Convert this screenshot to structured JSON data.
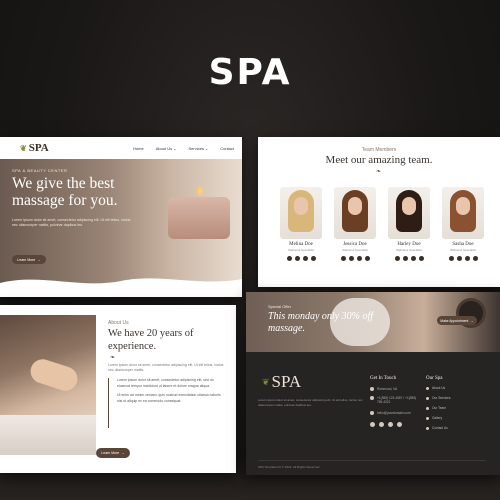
{
  "page": {
    "title": "SPA"
  },
  "hero_card": {
    "logo": "SPA",
    "nav": [
      {
        "label": "Home"
      },
      {
        "label": "About Us"
      },
      {
        "label": "Services"
      },
      {
        "label": "Contact"
      }
    ],
    "eyebrow": "SPA & BEAUTY CENTER",
    "heading": "We give the best massage for you.",
    "description": "Lorem ipsum dolor sit amet, consectetur adipiscing elit. Ut elit tellus, luctus nec ullamcorper mattis, pulvinar dapibus leo.",
    "button": "Learn More"
  },
  "team_card": {
    "eyebrow": "Team Members",
    "heading": "Meet our amazing team.",
    "members": [
      {
        "name": "Melina Doe",
        "role": "Wellness Specialist"
      },
      {
        "name": "Jessica Doe",
        "role": "Wellness Specialist"
      },
      {
        "name": "Harley Doe",
        "role": "Wellness Specialist"
      },
      {
        "name": "Sasha Doe",
        "role": "Wellness Specialist"
      }
    ]
  },
  "about_card": {
    "eyebrow": "About Us",
    "heading": "We have 20 years of experience.",
    "intro": "Lorem ipsum dolor sit amet, consectetur adipiscing elit. Ut elit tellus, luctus nec ullamcorper mattis.",
    "quote_1": "Lorem ipsum dolor sit amet, consectetur adipiscing elit, sed do eiusmod tempor incididunt ut labore et dolore magna aliqua.",
    "quote_2": "Ut enim ad minim veniam, quis nostrud exercitation ullamco laboris nisi ut aliquip ex ea commodo consequat.",
    "button": "Learn More"
  },
  "offer_card": {
    "eyebrow": "Special Offer",
    "heading": "This monday only 30% off massage.",
    "button": "Make Appointment"
  },
  "footer": {
    "logo": "SPA",
    "about": "Lorem ipsum dolor sit amet, consectetur adipiscing elit. Ut elit tellus, luctus nec ullamcorper mattis, pulvinar dapibus leo.",
    "contact_heading": "Get In Touch",
    "address": "Richmond, VA",
    "phone": "+1(555) 123-4567 / +1(555) 765-4321",
    "email": "hello@yourdomain.com",
    "links_heading": "Our Spa",
    "links": [
      {
        "label": "About Us"
      },
      {
        "label": "Our Services"
      },
      {
        "label": "Our Team"
      },
      {
        "label": "Gallery"
      },
      {
        "label": "Contact Us"
      }
    ],
    "copyright": "SPA Template Kit © 2022. All Rights Reserved."
  },
  "colors": {
    "brand_brown": "#5a4638",
    "leaf_green": "#7a8b3a",
    "footer_bg": "#262423",
    "page_bg": "#1c1a19"
  }
}
